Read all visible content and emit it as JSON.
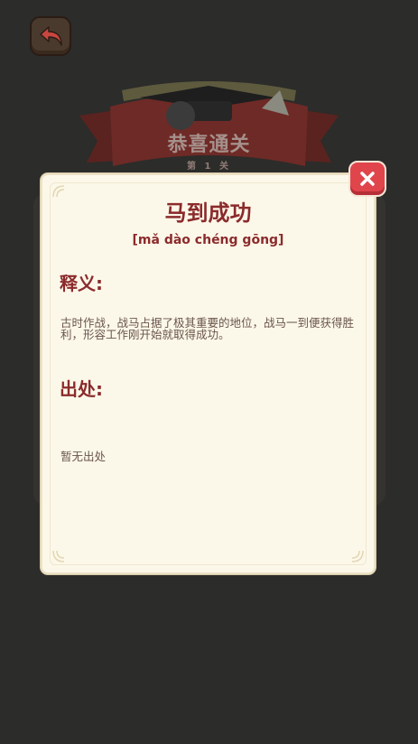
{
  "nav": {
    "back_icon": "back-arrow-icon"
  },
  "banner": {
    "title": "恭喜通关",
    "level": "第 1 关"
  },
  "idiom_modal": {
    "title": "马到成功",
    "pinyin": "[mǎ dào chéng gōng]",
    "meaning_heading": "释义:",
    "meaning_text": "古时作战，战马占据了极其重要的地位，战马一到便获得胜利，形容工作刚开始就取得成功。",
    "source_heading": "出处:",
    "source_text": "暂无出处",
    "close_icon": "close-icon"
  },
  "colors": {
    "accent": "#8b2b2c",
    "close_button": "#e0454b",
    "modal_background": "#fcf8e9",
    "page_background": "#2c2c2a"
  }
}
